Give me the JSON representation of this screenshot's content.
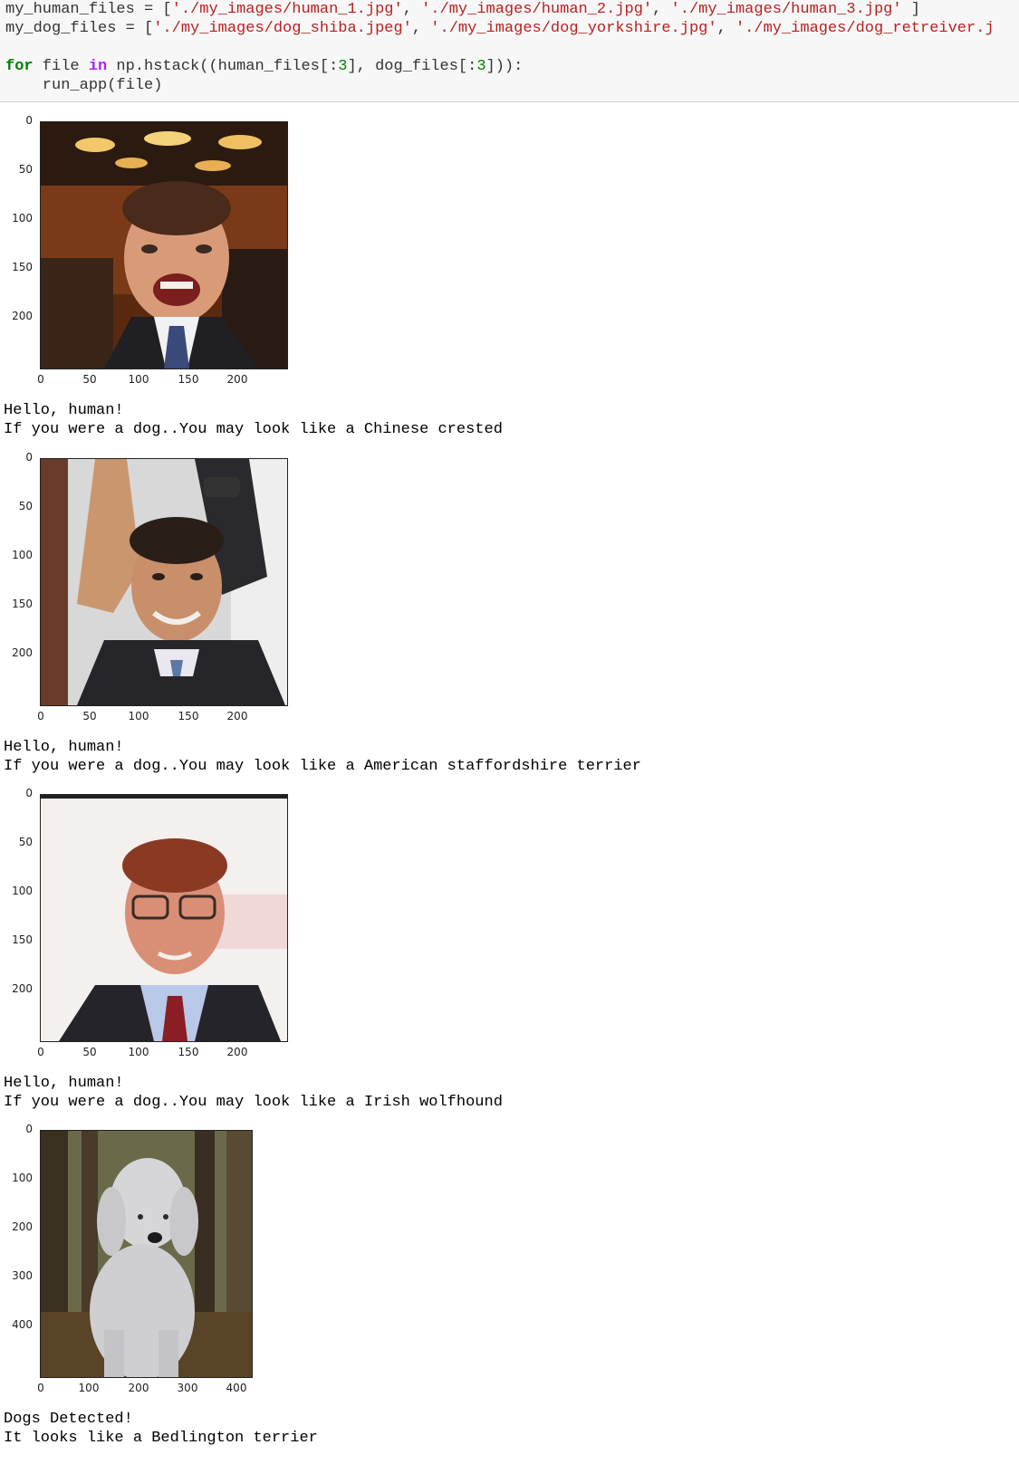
{
  "code": {
    "line1_var": "my_human_files",
    "line1_op": " = [",
    "line1_s1": "'./my_images/human_1.jpg'",
    "line1_s2": "'./my_images/human_2.jpg'",
    "line1_s3": "'./my_images/human_3.jpg'",
    "line1_end": " ]",
    "line2_var": "my_dog_files",
    "line2_op": " = [",
    "line2_s1": "'./my_images/dog_shiba.jpeg'",
    "line2_s2": "'./my_images/dog_yorkshire.jpg'",
    "line2_s3": "'./my_images/dog_retreiver.j",
    "comma": ", ",
    "line3_kw_for": "for",
    "line3_a": " file ",
    "line3_kw_in": "in",
    "line3_b": " np.hstack((human_files[:",
    "line3_n1": "3",
    "line3_c": "], dog_files[:",
    "line3_n2": "3",
    "line3_d": "])):",
    "line4": "    run_app(file)"
  },
  "outputs": [
    {
      "yticks": [
        "0",
        "50",
        "100",
        "150",
        "200"
      ],
      "xticks": [
        "0",
        "50",
        "100",
        "150",
        "200"
      ],
      "line1": "Hello, human!",
      "line2": "If you were a dog..You may look like a Chinese crested"
    },
    {
      "yticks": [
        "0",
        "50",
        "100",
        "150",
        "200"
      ],
      "xticks": [
        "0",
        "50",
        "100",
        "150",
        "200"
      ],
      "line1": "Hello, human!",
      "line2": "If you were a dog..You may look like a American staffordshire terrier"
    },
    {
      "yticks": [
        "0",
        "50",
        "100",
        "150",
        "200"
      ],
      "xticks": [
        "0",
        "50",
        "100",
        "150",
        "200"
      ],
      "line1": "Hello, human!",
      "line2": "If you were a dog..You may look like a Irish wolfhound"
    },
    {
      "yticks": [
        "0",
        "100",
        "200",
        "300",
        "400"
      ],
      "xticks": [
        "0",
        "100",
        "200",
        "300",
        "400"
      ],
      "line1": "Dogs Detected!",
      "line2": "It looks like a Bedlington terrier"
    }
  ],
  "colors": {
    "code_bg": "#f7f7f7",
    "keyword": "#008000",
    "keyword_in": "#aa22ff",
    "string": "#ba2121"
  }
}
